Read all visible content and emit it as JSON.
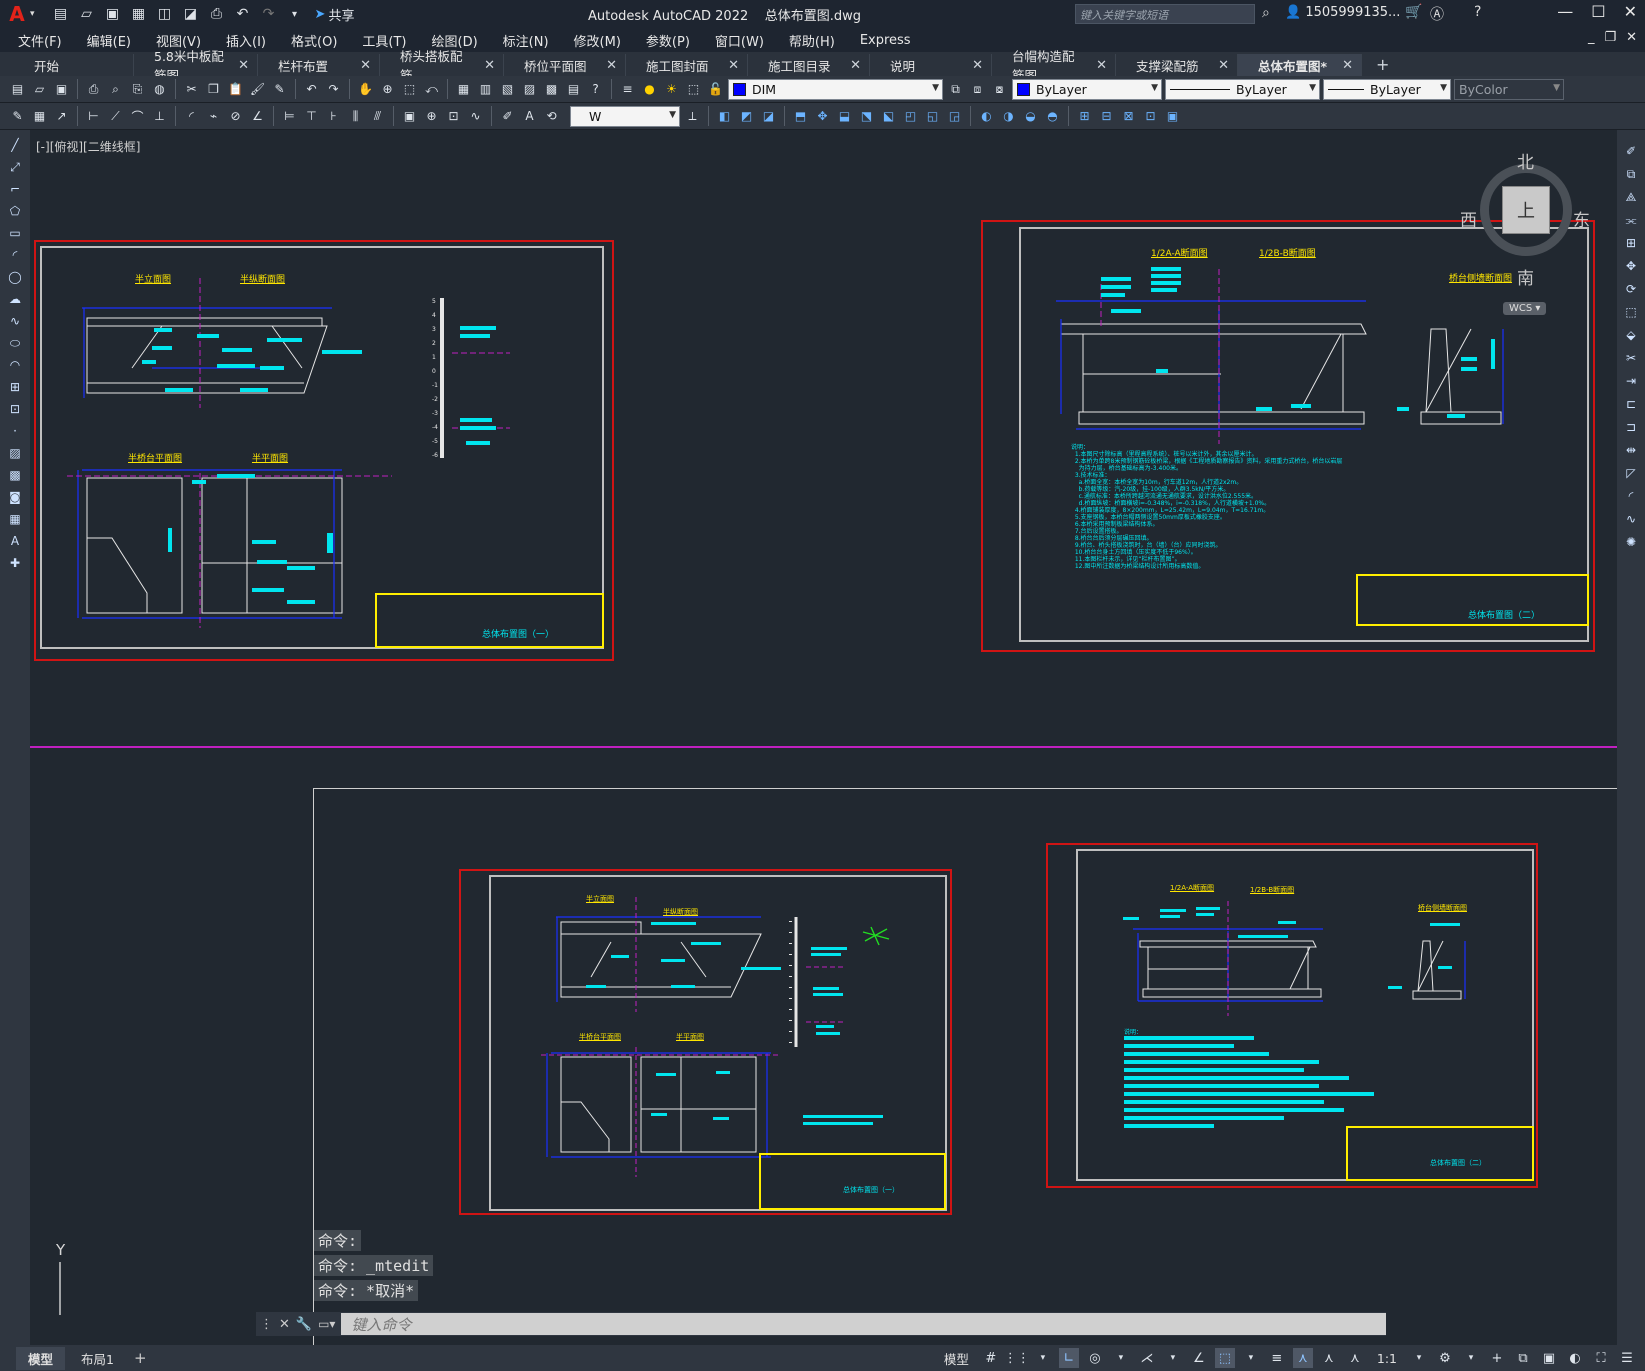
{
  "app": {
    "title": "Autodesk AutoCAD 2022    总体布置图.dwg",
    "logo": "A",
    "share_label": "共享",
    "search_placeholder": "键入关键字或短语",
    "user": "1505999135...",
    "colors": {
      "drawing_bg": "#212830",
      "frame_red": "#d01414",
      "annotation_cyan": "#00e5ee",
      "line_blue": "#1a30ff",
      "title_yellow": "#ffe600"
    }
  },
  "menu": [
    "文件(F)",
    "编辑(E)",
    "视图(V)",
    "插入(I)",
    "格式(O)",
    "工具(T)",
    "绘图(D)",
    "标注(N)",
    "修改(M)",
    "参数(P)",
    "窗口(W)",
    "帮助(H)",
    "Express"
  ],
  "tabs": [
    {
      "label": "开始",
      "closable": false,
      "width": 120
    },
    {
      "label": "5.8米中板配筋图",
      "closable": true,
      "width": 124
    },
    {
      "label": "栏杆布置",
      "closable": true,
      "width": 122
    },
    {
      "label": "桥头搭板配筋",
      "closable": true,
      "width": 124
    },
    {
      "label": "桥位平面图",
      "closable": true,
      "width": 122
    },
    {
      "label": "施工图封面",
      "closable": true,
      "width": 122
    },
    {
      "label": "施工图目录",
      "closable": true,
      "width": 122
    },
    {
      "label": "说明",
      "closable": true,
      "width": 122
    },
    {
      "label": "台帽构造配筋图",
      "closable": true,
      "width": 124
    },
    {
      "label": "支撑梁配筋",
      "closable": true,
      "width": 122
    },
    {
      "label": "总体布置图*",
      "closable": true,
      "width": 124,
      "active": true
    }
  ],
  "toolbar": {
    "layer_combo": "DIM",
    "color_combo": "ByLayer",
    "linetype_combo": "ByLayer",
    "lineweight_combo": "ByLayer",
    "plotstyle_combo": "ByColor",
    "dimstyle_combo": "W"
  },
  "viewport": {
    "label": "[-][俯视][二维线框]"
  },
  "viewcube": {
    "north": "北",
    "south": "南",
    "east": "东",
    "west": "西",
    "face": "上",
    "wcs": "WCS"
  },
  "sheets": {
    "sheet1": {
      "titles": [
        "半立面图",
        "半纵断面图",
        "半桥台平面图",
        "半平面图"
      ],
      "caption": "总体布置图（一）",
      "axis_ticks": [
        "5",
        "4",
        "3",
        "2",
        "1",
        "0",
        "-1",
        "-2",
        "-3",
        "-4",
        "-5",
        "-6"
      ]
    },
    "sheet2": {
      "titles": [
        "1/2A-A断面图",
        "1/2B-B断面图",
        "桥台侧墙断面图"
      ],
      "caption": "总体布置图（二）",
      "notes": "说明：\n  1.本图尺寸除标高（里程高程系统）、桩号以米计外，其余以厘米计。\n  2.本桥为单跨8米预制钢筋砼板桥梁，根据《工程地质勘察报告》资料，采用重力式桥台，桥台以岩层\n    为持力层，桥台基础标高为-3.400米。\n  3.技术标准：\n    a.桥面全宽：本桥全宽为10m，行车道12m，人行道2x2m。\n    b.荷载等级：汽-20级，挂-100级，人群3.5kN/平方米。\n    c.通航标准：本桥所跨越河流通无通航要求，设计洪水位2.555米。\n    d.桥面纵坡：桥面横坡i=-0.348%，i=-0.318%，人行道横坡+1.0%。\n  4.桥面铺装厚度，8×200mm，L=25.42m，L=9.04m，T=16.71m。\n  5.支座钢板，本桥台帽两侧设置50mm厚板式橡胶支座。\n  6.本桥采用预制板梁结构体系。\n  7.台后设置搭板。\n  8.桥台台后须分层碾压回填。\n  9.桥台、桥头搭板浇筑时，台（墙）（台）应同时浇筑。\n  10.桥台台身土方回填（压实度不低于96%）。\n  11.本图栏杆未示，详见“栏杆布置图”。\n  12.图中所注数据为桥梁结构设计所用标高数值。"
    },
    "sheet3": {
      "titles": [
        "半立面图",
        "半纵断面图",
        "半桥台平面图",
        "半平面图"
      ],
      "caption": "总体布置图（一）",
      "ticks_count": 12
    },
    "sheet4": {
      "titles": [
        "1/2A-A断面图",
        "1/2B-B断面图",
        "桥台侧墙断面图"
      ],
      "caption": "总体布置图（二）",
      "notes_label": "说明："
    }
  },
  "command": {
    "history": [
      "命令:",
      "命令: _mtedit",
      "命令: *取消*"
    ],
    "placeholder": "键入命令"
  },
  "layouts": [
    {
      "label": "模型",
      "active": true
    },
    {
      "label": "布局1",
      "active": false
    }
  ],
  "status": {
    "model_label": "模型",
    "scale": "1:1"
  }
}
